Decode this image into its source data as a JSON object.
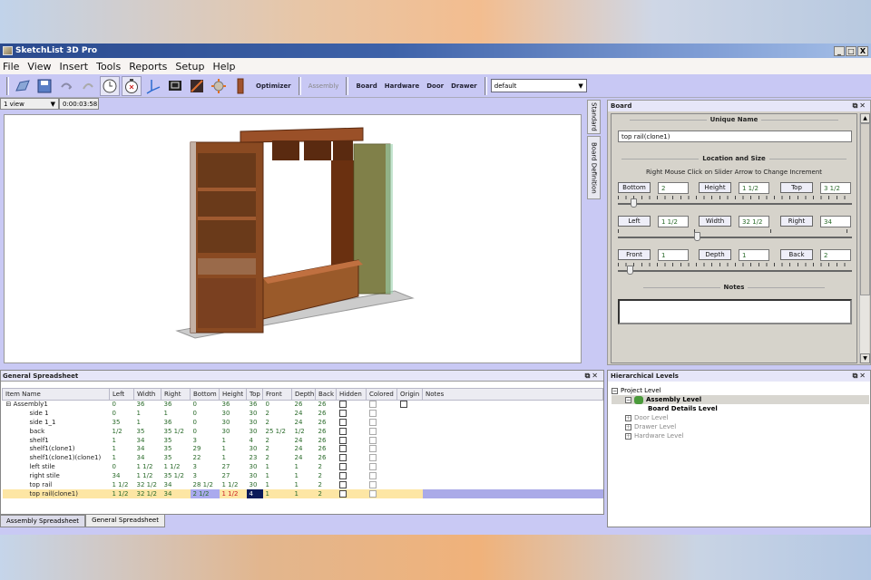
{
  "window": {
    "title": "SketchList 3D Pro",
    "controls": [
      "_",
      "□",
      "X"
    ]
  },
  "menu": [
    "File",
    "View",
    "Insert",
    "Tools",
    "Reports",
    "Setup",
    "Help"
  ],
  "toolbar": {
    "icons": [
      "open-folder-icon",
      "save-disk-icon",
      "undo-icon",
      "redo-icon",
      "clock-icon",
      "stopwatch-icon",
      "axes-icon",
      "monitor-icon",
      "pdf-icon",
      "target-icon",
      "board-icon"
    ],
    "optimizer": "Optimizer",
    "assembly": "Assembly",
    "board": "Board",
    "hardware": "Hardware",
    "door": "Door",
    "drawer": "Drawer",
    "style_select": "default"
  },
  "view": {
    "selector": "1 view",
    "timer": "0:00:03:58"
  },
  "side_tabs": [
    "Standard",
    "Board Definition"
  ],
  "board_panel": {
    "title": "Board",
    "unique_name_label": "Unique Name",
    "unique_name": "top rail(clone1)",
    "location_label": "Location and Size",
    "hint": "Right Mouse Click on Slider Arrow to Change Increment",
    "rows": [
      [
        {
          "label": "Bottom",
          "value": "2"
        },
        {
          "label": "Height",
          "value": "1 1/2"
        },
        {
          "label": "Top",
          "value": "3 1/2"
        }
      ],
      [
        {
          "label": "Left",
          "value": "1 1/2"
        },
        {
          "label": "Width",
          "value": "32 1/2"
        },
        {
          "label": "Right",
          "value": "34"
        }
      ],
      [
        {
          "label": "Front",
          "value": "1"
        },
        {
          "label": "Depth",
          "value": "1"
        },
        {
          "label": "Back",
          "value": "2"
        }
      ]
    ],
    "notes_label": "Notes",
    "notes": ""
  },
  "spreadsheet": {
    "title": "General Spreadsheet",
    "columns": [
      "Item Name",
      "Left",
      "Width",
      "Right",
      "Bottom",
      "Height",
      "Top",
      "Front",
      "Depth",
      "Back",
      "Hidden",
      "Colored",
      "Origin",
      "Notes"
    ],
    "rows": [
      {
        "name": "Assembly1",
        "level": 0,
        "expand": "-",
        "cells": [
          "0",
          "36",
          "36",
          "0",
          "36",
          "36",
          "0",
          "26",
          "26"
        ],
        "origin": true
      },
      {
        "name": "side 1",
        "level": 1,
        "cells": [
          "0",
          "1",
          "1",
          "0",
          "30",
          "30",
          "2",
          "24",
          "26"
        ]
      },
      {
        "name": "side 1_1",
        "level": 1,
        "cells": [
          "35",
          "1",
          "36",
          "0",
          "30",
          "30",
          "2",
          "24",
          "26"
        ]
      },
      {
        "name": "back",
        "level": 1,
        "cells": [
          "1/2",
          "35",
          "35 1/2",
          "0",
          "30",
          "30",
          "25 1/2",
          "1/2",
          "26"
        ]
      },
      {
        "name": "shelf1",
        "level": 1,
        "cells": [
          "1",
          "34",
          "35",
          "3",
          "1",
          "4",
          "2",
          "24",
          "26"
        ]
      },
      {
        "name": "shelf1(clone1)",
        "level": 1,
        "cells": [
          "1",
          "34",
          "35",
          "29",
          "1",
          "30",
          "2",
          "24",
          "26"
        ]
      },
      {
        "name": "shelf1(clone1)(clone1)",
        "level": 1,
        "cells": [
          "1",
          "34",
          "35",
          "22",
          "1",
          "23",
          "2",
          "24",
          "26"
        ]
      },
      {
        "name": "left stile",
        "level": 1,
        "cells": [
          "0",
          "1 1/2",
          "1 1/2",
          "3",
          "27",
          "30",
          "1",
          "1",
          "2"
        ]
      },
      {
        "name": "right stile",
        "level": 1,
        "cells": [
          "34",
          "1 1/2",
          "35 1/2",
          "3",
          "27",
          "30",
          "1",
          "1",
          "2"
        ]
      },
      {
        "name": "top rail",
        "level": 1,
        "cells": [
          "1 1/2",
          "32 1/2",
          "34",
          "28 1/2",
          "1 1/2",
          "30",
          "1",
          "1",
          "2"
        ]
      },
      {
        "name": "top rail(clone1)",
        "level": 1,
        "cells": [
          "1 1/2",
          "32 1/2",
          "34",
          "2 1/2",
          "1 1/2",
          "4",
          "1",
          "1",
          "2"
        ],
        "selected": true
      }
    ],
    "tabs": [
      "Assembly Spreadsheet",
      "General Spreadsheet"
    ],
    "active_tab": 1
  },
  "hierarchy": {
    "title": "Hierarchical Levels",
    "nodes": [
      {
        "label": "Project Level",
        "expand": "-",
        "indent": 0
      },
      {
        "label": "Assembly Level",
        "expand": "-",
        "indent": 1,
        "selected": true
      },
      {
        "label": "Board Details Level",
        "indent": 2
      },
      {
        "label": "Door Level",
        "expand": "+",
        "indent": 1,
        "dim": true
      },
      {
        "label": "Drawer Level",
        "expand": "+",
        "indent": 1,
        "dim": true
      },
      {
        "label": "Hardware Level",
        "expand": "+",
        "indent": 1,
        "dim": true
      }
    ]
  }
}
